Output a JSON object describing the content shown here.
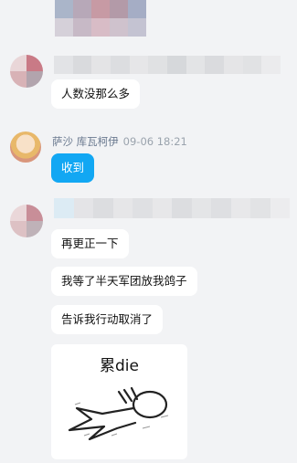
{
  "messages": [
    {
      "type": "text",
      "text": "人数没那么多"
    },
    {
      "type": "text",
      "sender": "萨沙 库瓦柯伊",
      "timestamp": "09-06 18:21",
      "text": "收到"
    },
    {
      "type": "text",
      "text": "再更正一下"
    },
    {
      "type": "text",
      "text": "我等了半天军团放我鸽子"
    },
    {
      "type": "text",
      "text": "告诉我行动取消了"
    },
    {
      "type": "sticker",
      "caption": "累die"
    }
  ],
  "colors": {
    "background": "#f2f3f5",
    "bubble": "#ffffff",
    "bubble_self_accent": "#12a7f3",
    "sender_name": "#6b7a90",
    "timestamp": "#9aa3ad"
  },
  "icons": {
    "blurred_avatar": "pixelated-avatar-icon",
    "sender_avatar": "anime-avatar-icon",
    "sticker_figure": "tired-figure-icon"
  }
}
